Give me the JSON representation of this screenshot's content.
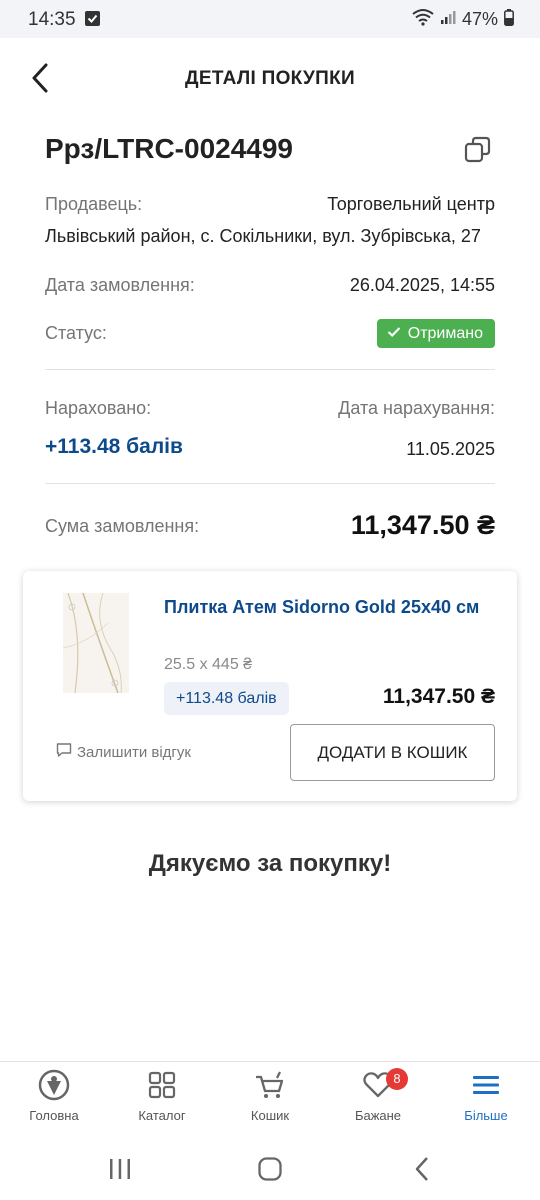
{
  "status_bar": {
    "time": "14:35",
    "battery": "47%",
    "icons": [
      "check-square-icon",
      "wifi-icon",
      "signal-icon",
      "battery-icon"
    ]
  },
  "header": {
    "title": "ДЕТАЛІ ПОКУПКИ",
    "back_icon": "chevron-left-icon"
  },
  "order": {
    "id": "Ррз/LTRC-0024499",
    "copy_icon": "copy-icon",
    "seller_label": "Продавець:",
    "seller_name": "Торговельний центр",
    "seller_address": "Львівський район, с. Сокільники, вул. Зубрівська, 27",
    "date_label": "Дата замовлення:",
    "date_value": "26.04.2025, 14:55",
    "status_label": "Статус:",
    "status_value": "Отримано",
    "status_color": "#4caf50",
    "accrued_label": "Нараховано:",
    "accrued_value": "+113.48 балів",
    "accrual_date_label": "Дата нарахування:",
    "accrual_date_value": "11.05.2025",
    "total_label": "Сума замовлення:",
    "total_value": "11,347.50 ₴"
  },
  "product": {
    "name": "Плитка Атем Sidorno Gold 25x40 см",
    "quantity_price": "25.5 x 445 ₴",
    "points": "+113.48 балів",
    "price": "11,347.50 ₴",
    "review_label": "Залишити відгук",
    "review_icon": "comment-icon",
    "add_to_cart_label": "ДОДАТИ В КОШИК"
  },
  "thanks_message": "Дякуємо за покупку!",
  "bottom_nav": {
    "items": [
      {
        "label": "Головна",
        "icon": "home-icon"
      },
      {
        "label": "Каталог",
        "icon": "grid-icon"
      },
      {
        "label": "Кошик",
        "icon": "cart-icon"
      },
      {
        "label": "Бажане",
        "icon": "heart-icon",
        "badge": "8"
      },
      {
        "label": "Більше",
        "icon": "menu-icon",
        "active": true
      }
    ]
  },
  "colors": {
    "accent": "#0d4a8c",
    "active_nav": "#1f6fc5",
    "badge": "#e53935"
  }
}
